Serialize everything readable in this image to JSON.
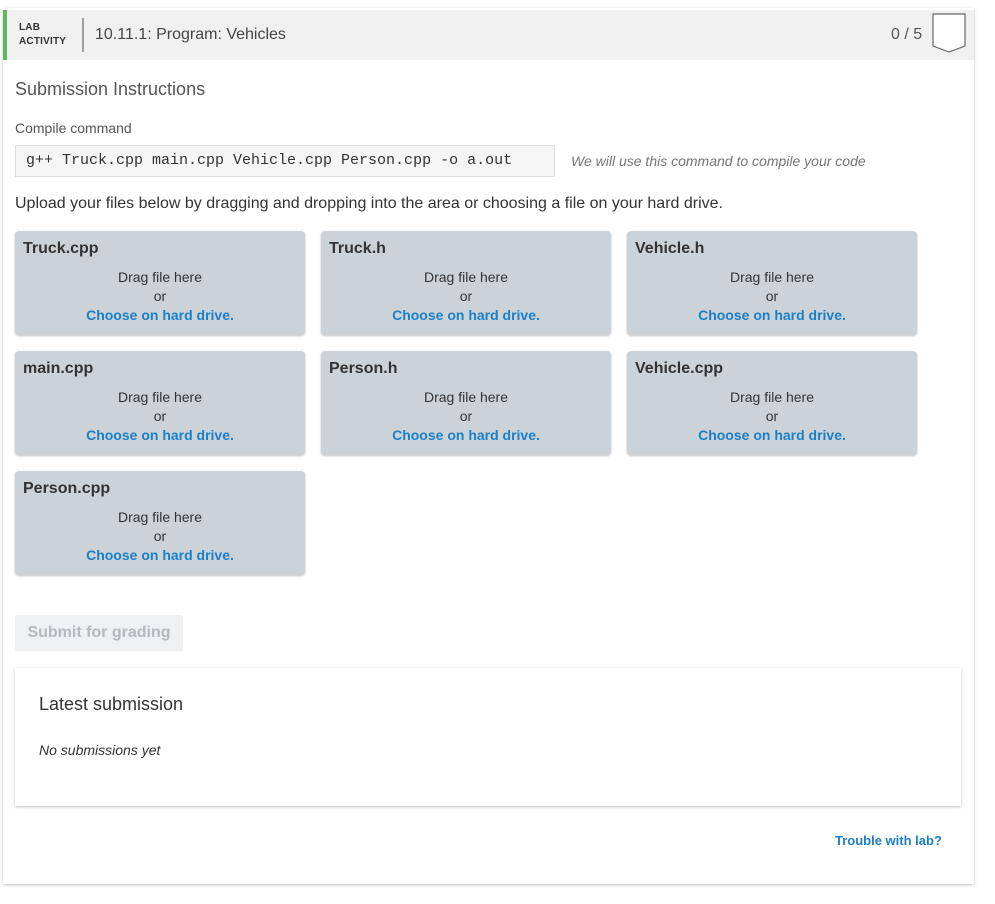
{
  "header": {
    "lab_line1": "LAB",
    "lab_line2": "ACTIVITY",
    "title": "10.11.1: Program: Vehicles",
    "score": "0 / 5",
    "badge_icon": "completion-badge-icon",
    "accent_color": "#5cb85c"
  },
  "instructions": {
    "title": "Submission Instructions",
    "compile_label": "Compile command",
    "compile_command": "g++ Truck.cpp main.cpp Vehicle.cpp Person.cpp -o a.out",
    "compile_note": "We will use this command to compile your code",
    "upload_text": "Upload your files below by dragging and dropping into the area or choosing a file on your hard drive."
  },
  "files": [
    {
      "name": "Truck.cpp",
      "drag": "Drag file here",
      "or": "or",
      "choose": "Choose on hard drive."
    },
    {
      "name": "Truck.h",
      "drag": "Drag file here",
      "or": "or",
      "choose": "Choose on hard drive."
    },
    {
      "name": "Vehicle.h",
      "drag": "Drag file here",
      "or": "or",
      "choose": "Choose on hard drive."
    },
    {
      "name": "main.cpp",
      "drag": "Drag file here",
      "or": "or",
      "choose": "Choose on hard drive."
    },
    {
      "name": "Person.h",
      "drag": "Drag file here",
      "or": "or",
      "choose": "Choose on hard drive."
    },
    {
      "name": "Vehicle.cpp",
      "drag": "Drag file here",
      "or": "or",
      "choose": "Choose on hard drive."
    },
    {
      "name": "Person.cpp",
      "drag": "Drag file here",
      "or": "or",
      "choose": "Choose on hard drive."
    }
  ],
  "submit_label": "Submit for grading",
  "latest": {
    "title": "Latest submission",
    "empty": "No submissions yet"
  },
  "trouble_link": "Trouble with lab?"
}
